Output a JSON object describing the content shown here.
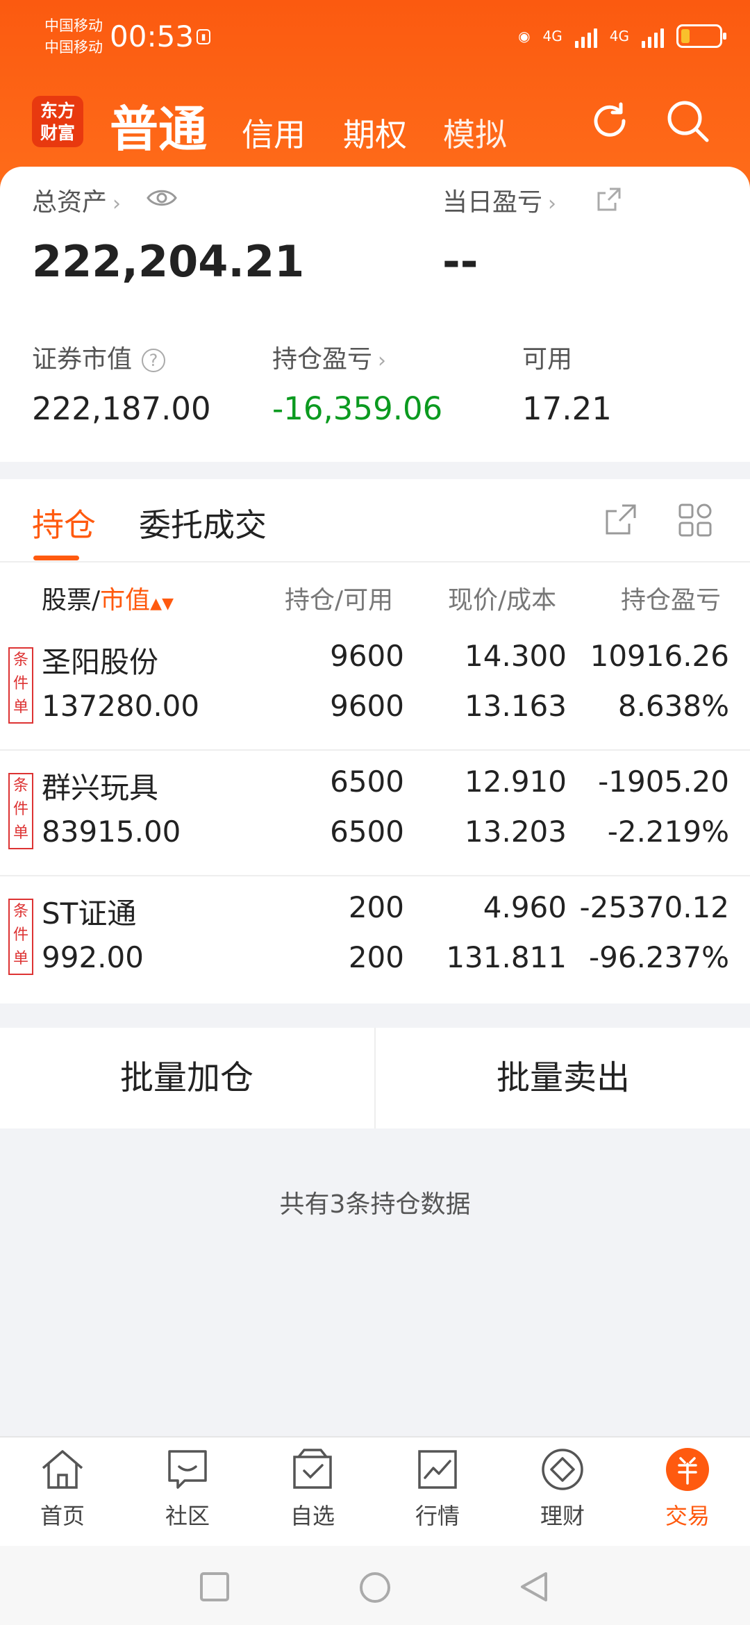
{
  "status": {
    "carrier1": "中国移动",
    "carrier2": "中国移动",
    "time": "00:53",
    "net1": "4G",
    "net2": "4G"
  },
  "topnav": {
    "logo": "东方财富",
    "tabs": [
      "普通",
      "信用",
      "期权",
      "模拟"
    ]
  },
  "summary": {
    "total_assets_label": "总资产",
    "total_assets": "222,204.21",
    "daily_pl_label": "当日盈亏",
    "daily_pl": "--",
    "market_value_label": "证券市值",
    "market_value": "222,187.00",
    "position_pl_label": "持仓盈亏",
    "position_pl": "-16,359.06",
    "available_label": "可用",
    "available": "17.21"
  },
  "positions": {
    "tabs": [
      "持仓",
      "委托成交"
    ],
    "columns": {
      "stock": "股票/",
      "market_value": "市值",
      "holding": "持仓/可用",
      "price": "现价/成本",
      "pl": "持仓盈亏"
    },
    "tag": "条件单",
    "rows": [
      {
        "name": "圣阳股份",
        "market_value": "137280.00",
        "holding": "9600",
        "available": "9600",
        "price": "14.300",
        "cost": "13.163",
        "pl": "10916.26",
        "pl_pct": "8.638%"
      },
      {
        "name": "群兴玩具",
        "market_value": "83915.00",
        "holding": "6500",
        "available": "6500",
        "price": "12.910",
        "cost": "13.203",
        "pl": "-1905.20",
        "pl_pct": "-2.219%"
      },
      {
        "name": "ST证通",
        "market_value": "992.00",
        "holding": "200",
        "available": "200",
        "price": "4.960",
        "cost": "131.811",
        "pl": "-25370.12",
        "pl_pct": "-96.237%"
      }
    ]
  },
  "actions": {
    "add": "批量加仓",
    "sell": "批量卖出"
  },
  "count_text": "共有3条持仓数据",
  "bottom_nav": [
    {
      "label": "首页",
      "icon": "home-icon"
    },
    {
      "label": "社区",
      "icon": "chat-icon"
    },
    {
      "label": "自选",
      "icon": "watchlist-icon"
    },
    {
      "label": "行情",
      "icon": "chart-icon"
    },
    {
      "label": "理财",
      "icon": "wealth-icon"
    },
    {
      "label": "交易",
      "icon": "trade-icon"
    }
  ],
  "colors": {
    "accent": "#ff5a0f",
    "gain": "#e13535",
    "loss": "#0b9a1f"
  }
}
